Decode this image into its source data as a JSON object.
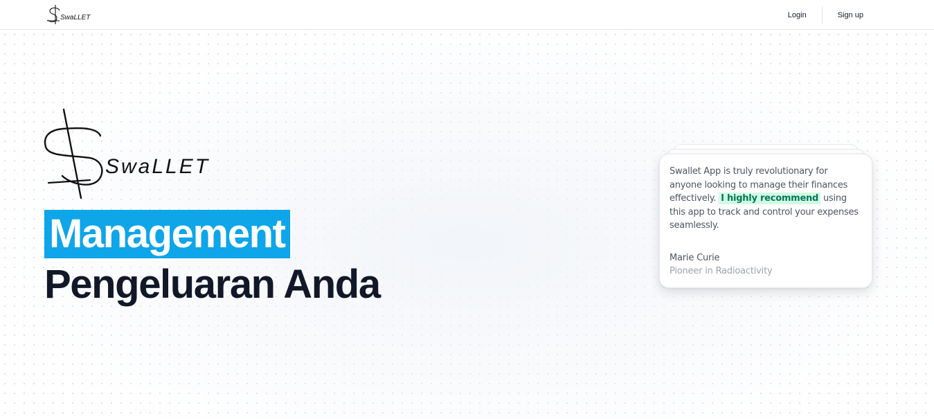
{
  "navbar": {
    "logo_text": "SwaLLET",
    "login_label": "Login",
    "signup_label": "Sign up"
  },
  "hero": {
    "logo_text": "SwaLLET",
    "headline_highlight": "Management",
    "headline_rest": "Pengeluaran Anda"
  },
  "testimonial": {
    "text_before": "Swallet App is truly revolutionary for anyone looking to manage their finances effectively. ",
    "highlight": "I highly recommend",
    "text_after": " using this app to track and control your expenses seamlessly.",
    "author_name": "Marie Curie",
    "author_title": "Pioneer in Radioactivity"
  },
  "colors": {
    "accent": "#0ea5e9",
    "headline": "#111827",
    "highlight_bg": "#d1fae5",
    "highlight_text": "#047857"
  }
}
